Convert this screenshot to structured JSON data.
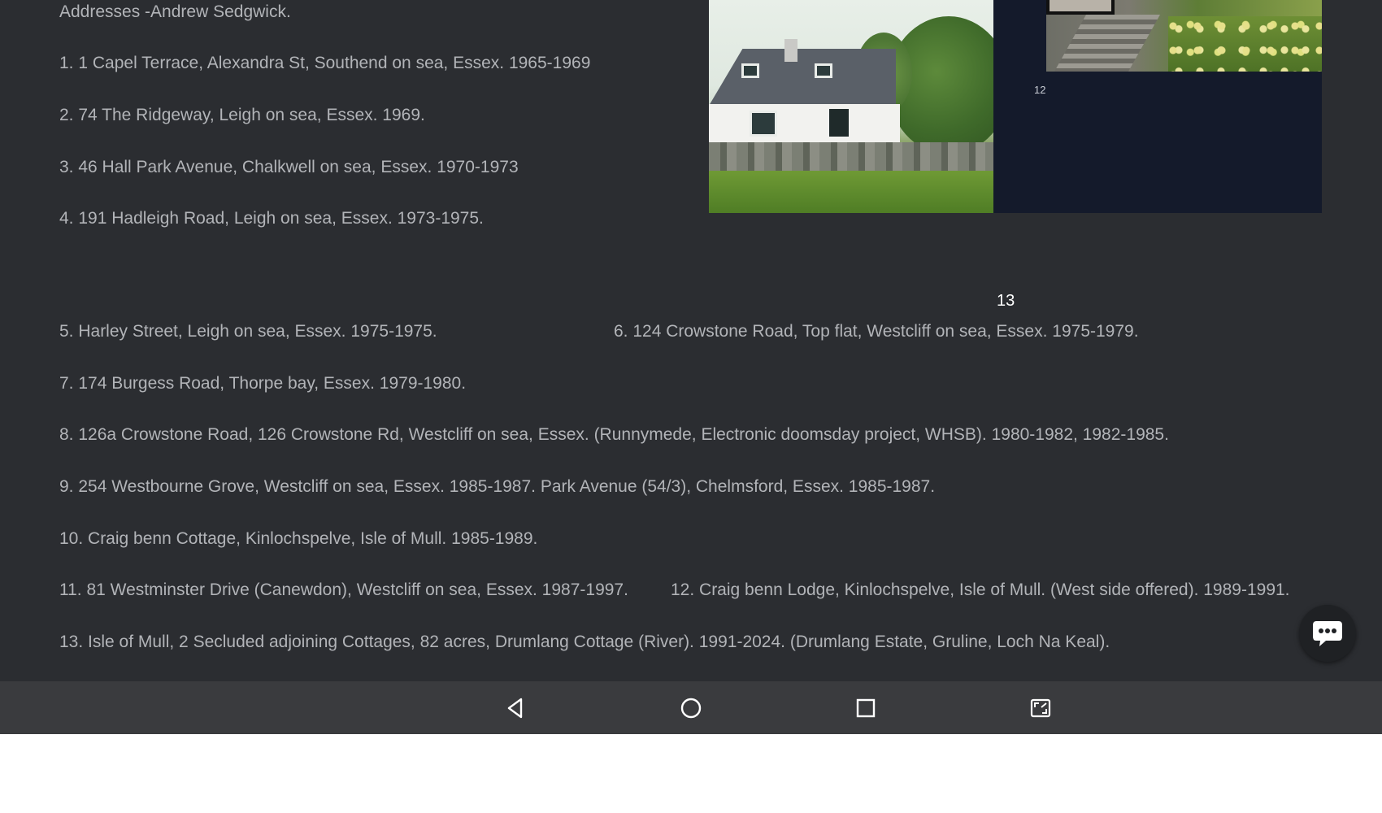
{
  "document": {
    "heading": "Addresses -Andrew Sedgwick.",
    "page_number": "13",
    "image_label": "12",
    "lines": {
      "l1": "1. 1 Capel Terrace, Alexandra St, Southend on sea, Essex. 1965-1969",
      "l2": "2. 74 The Ridgeway, Leigh on sea, Essex. 1969.",
      "l3": "3. 46 Hall Park Avenue, Chalkwell on sea, Essex. 1970-1973",
      "l4": "4. 191 Hadleigh Road, Leigh on sea, Essex. 1973-1975.",
      "l5": "5. Harley Street, Leigh on sea, Essex.  1975-1975.",
      "l6": "6. 124 Crowstone Road, Top flat, Westcliff on sea, Essex.  1975-1979.",
      "l7": "7. 174 Burgess Road, Thorpe bay, Essex.  1979-1980.",
      "l8": "8. 126a Crowstone Road, 126 Crowstone Rd, Westcliff on sea, Essex. (Runnymede, Electronic doomsday project, WHSB). 1980-1982, 1982-1985.",
      "l9": "9. 254 Westbourne Grove, Westcliff  on sea, Essex.  1985-1987.   Park Avenue (54/3), Chelmsford, Essex. 1985-1987.",
      "l10": "10. Craig benn Cottage, Kinlochspelve, Isle of Mull. 1985-1989.",
      "l11": "11. 81 Westminster Drive (Canewdon), Westcliff on sea, Essex.  1987-1997.",
      "l12": "12. Craig benn Lodge, Kinlochspelve, Isle of Mull. (West side offered). 1989-1991.",
      "l13": "13. Isle of Mull, 2 Secluded adjoining Cottages, 82 acres, Drumlang Cottage (River).  1991-2024.   (Drumlang Estate, Gruline, Loch Na Keal)."
    }
  },
  "icons": {
    "chat": "chat-bubble-icon",
    "back": "back-triangle-icon",
    "home": "home-circle-icon",
    "recents": "recents-square-icon",
    "screenshot": "screenshot-icon"
  },
  "colors": {
    "background": "#2b2d31",
    "text": "#b2b4b8",
    "navbar": "#3a3b3e"
  }
}
